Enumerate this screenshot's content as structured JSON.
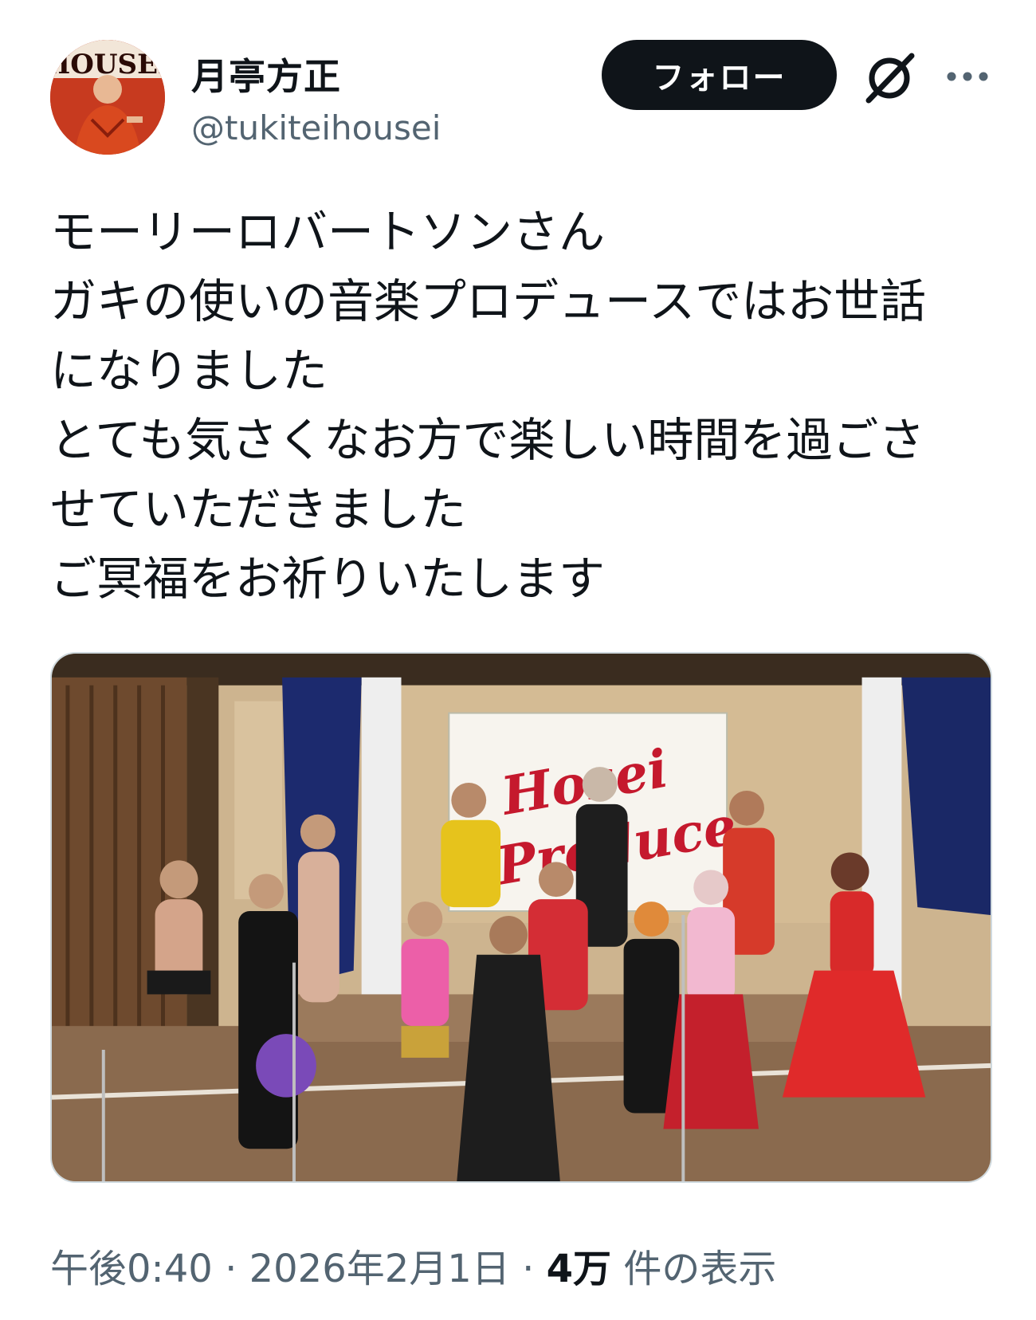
{
  "author": {
    "display_name": "月亭方正",
    "handle": "@tukiteihousei",
    "avatar_text": "HOUSEI"
  },
  "actions": {
    "follow_label": "フォロー",
    "grok_icon": "grok-icon",
    "more_icon": "more-icon"
  },
  "tweet": {
    "lines": [
      "モーリーロバートソンさん",
      "ガキの使いの音楽プロデュースではお世話",
      "になりました",
      "とても気さくなお方で楽しい時間を過ごさ",
      "せていただきました",
      "ご冥福をお祈りいたします"
    ]
  },
  "media": {
    "sign_line1": "Hosei",
    "sign_line2": "Produce"
  },
  "meta": {
    "time": "午後0:40",
    "separator": "·",
    "date": "2026年2月1日",
    "views_count": "4万",
    "views_label": "件の表示"
  },
  "colors": {
    "text": "#0f1419",
    "secondary": "#536471",
    "button_bg": "#0f1419"
  }
}
